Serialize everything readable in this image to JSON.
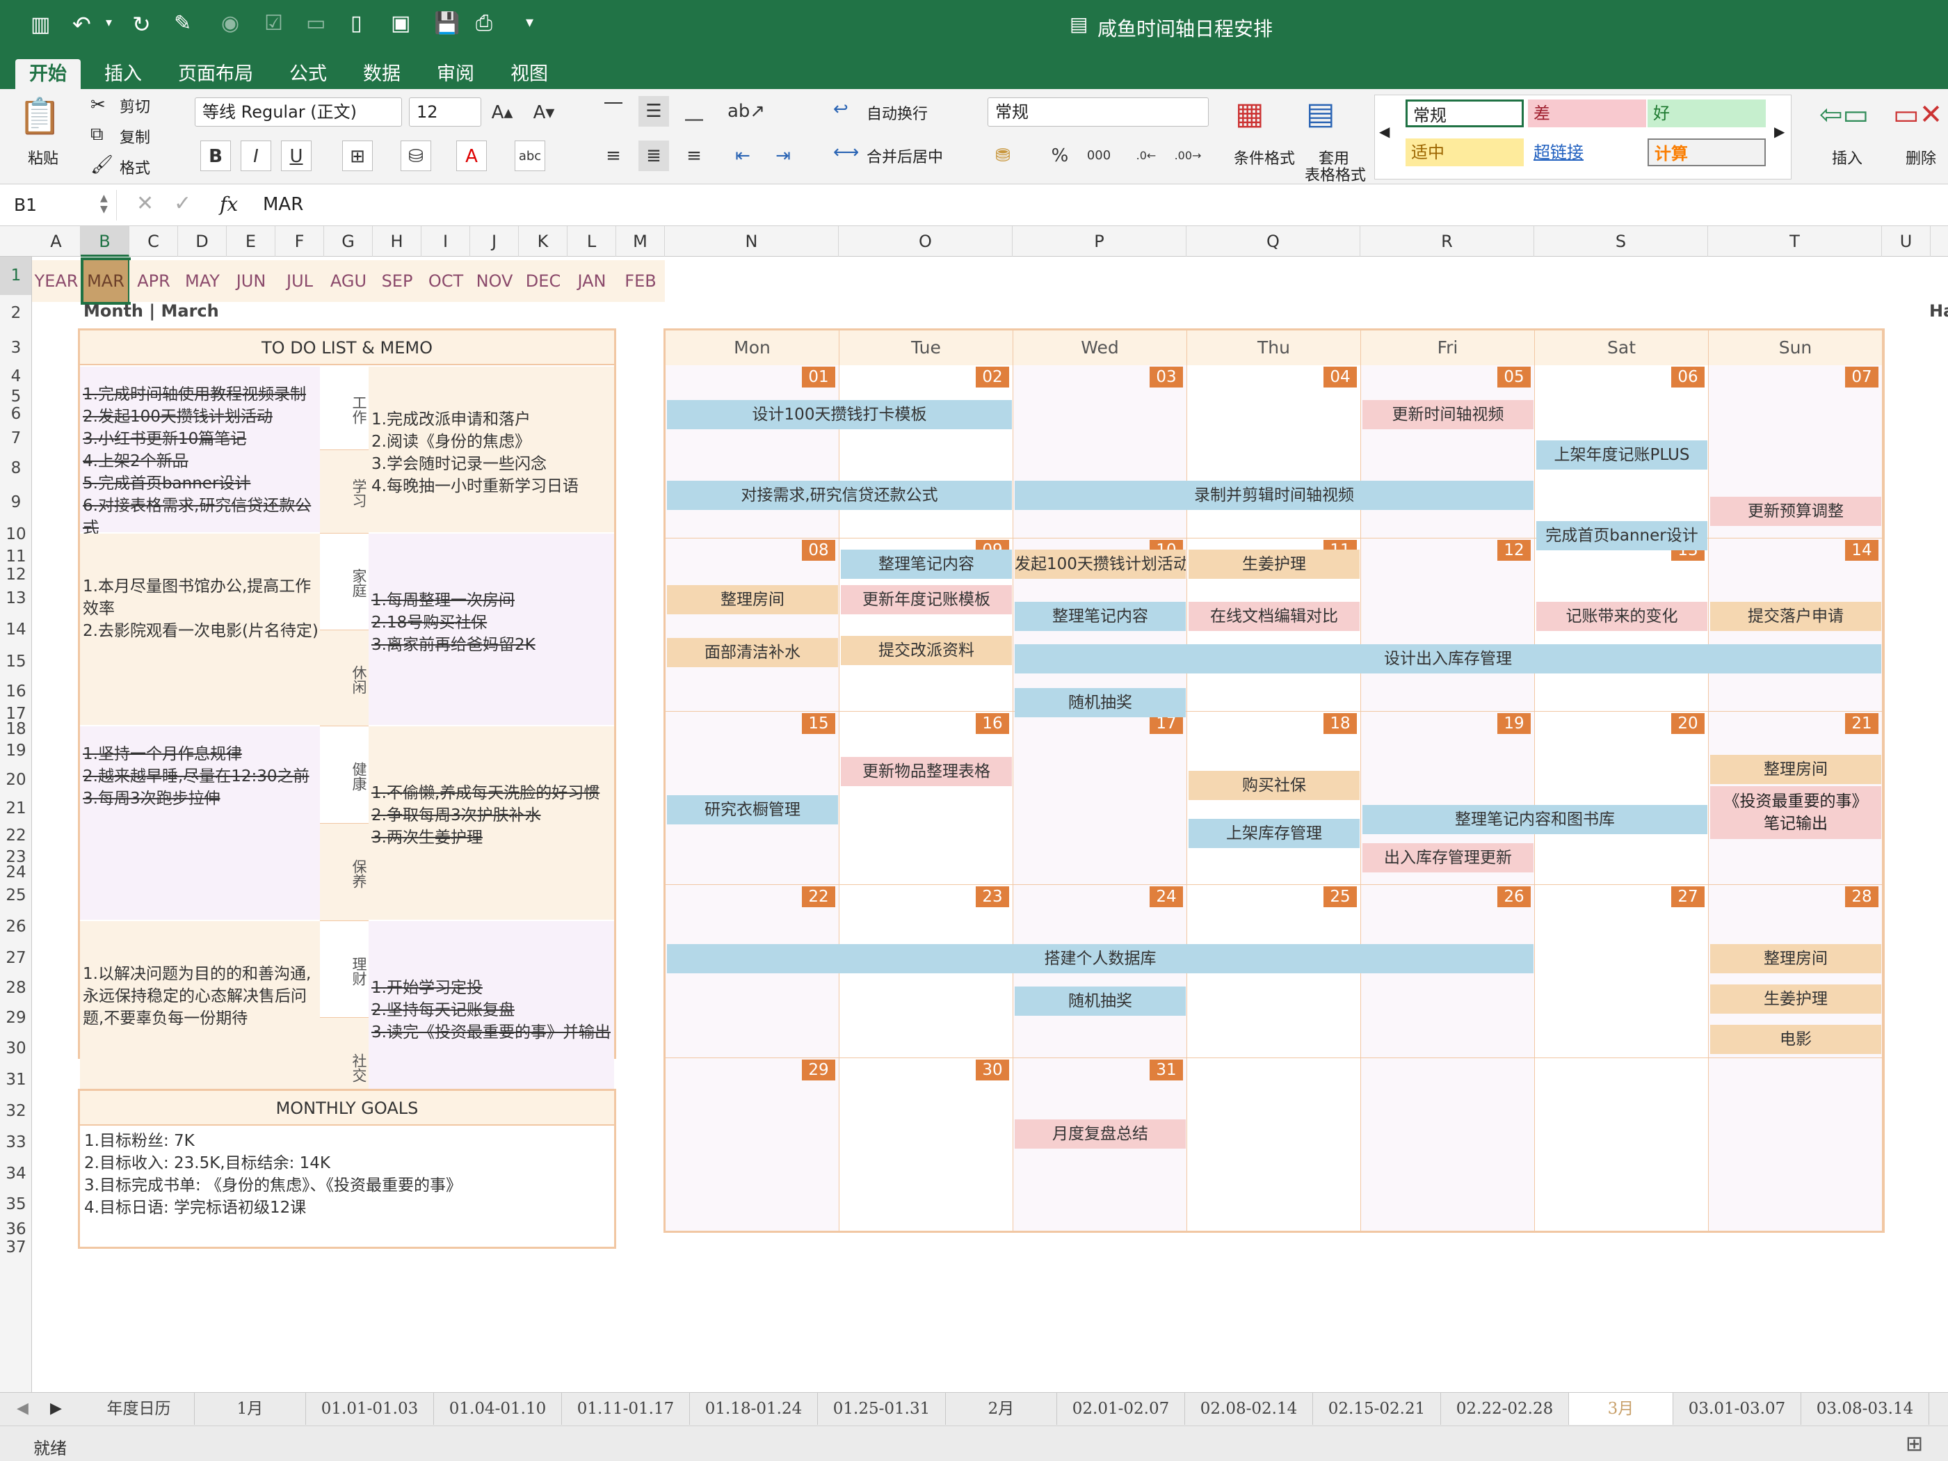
{
  "window": {
    "title": "咸鱼时间轴日程安排"
  },
  "ribbon_tabs": [
    "开始",
    "插入",
    "页面布局",
    "公式",
    "数据",
    "审阅",
    "视图"
  ],
  "ribbon": {
    "paste": "粘贴",
    "cut": "剪切",
    "copy": "复制",
    "format_painter": "格式",
    "font_name": "等线 Regular (正文)",
    "font_size": "12",
    "wrap_text": "自动换行",
    "merge_center": "合并后居中",
    "number_format": "常规",
    "conditional_format": "条件格式",
    "table_format_1": "套用",
    "table_format_2": "表格格式",
    "styles": {
      "normal": "常规",
      "bad": "差",
      "good": "好",
      "neutral": "适中",
      "hyperlink": "超链接",
      "calc": "计算"
    },
    "insert": "插入",
    "delete": "删除"
  },
  "formula_bar": {
    "cell_ref": "B1",
    "fx": "fx",
    "value": "MAR"
  },
  "columns": [
    "A",
    "B",
    "C",
    "D",
    "E",
    "F",
    "G",
    "H",
    "I",
    "J",
    "K",
    "L",
    "M",
    "N",
    "O",
    "P",
    "Q",
    "R",
    "S",
    "T",
    "U"
  ],
  "rows": [
    "1",
    "2",
    "3",
    "4",
    "5",
    "6",
    "7",
    "8",
    "9",
    "10",
    "11",
    "12",
    "13",
    "14",
    "15",
    "16",
    "17",
    "18",
    "19",
    "20",
    "21",
    "22",
    "23",
    "24",
    "25",
    "26",
    "27",
    "28",
    "29",
    "30",
    "31",
    "32",
    "33",
    "34",
    "35",
    "36",
    "37"
  ],
  "month_strip": [
    "YEAR",
    "MAR",
    "APR",
    "MAY",
    "JUN",
    "JUL",
    "AGU",
    "SEP",
    "OCT",
    "NOV",
    "DEC",
    "JAN",
    "FEB"
  ],
  "month_label": "Month | March",
  "right_edge_text": "Ha",
  "todo": {
    "title": "TO DO LIST & MEMO",
    "sections": [
      {
        "left": [
          "1.完成时间轴使用教程视频录制",
          "2.发起100天攒钱计划活动",
          "3.小红书更新10篇笔记",
          "4.上架2个新品",
          "5.完成首页banner设计",
          "6.对接表格需求,研究信贷还款公式"
        ],
        "cats": [
          "工作",
          "学习"
        ],
        "right": [
          "1.完成改派申请和落户",
          "2.阅读《身份的焦虑》",
          "3.学会随时记录一些闪念",
          "4.每晚抽一小时重新学习日语"
        ]
      },
      {
        "left": [
          "1.本月尽量图书馆办公,提高工作效率",
          "2.去影院观看一次电影(片名待定)"
        ],
        "cats": [
          "家庭",
          "休闲"
        ],
        "right": [
          "1.每周整理一次房间",
          "2.18号购买社保",
          "3.离家前再给爸妈留2K"
        ]
      },
      {
        "left": [
          "1.坚持一个月作息规律",
          "2.越来越早睡,尽量在12:30之前",
          "3.每周3次跑步拉伸"
        ],
        "cats": [
          "健康",
          "保养"
        ],
        "right": [
          "1.不偷懒,养成每天洗脸的好习惯",
          "2.争取每周3次护肤补水",
          "3.两次生姜护理"
        ]
      },
      {
        "left": [
          "1.以解决问题为目的的和善沟通,永远保持稳定的心态解决售后问题,不要辜负每一份期待"
        ],
        "cats": [
          "理财",
          "社交"
        ],
        "right": [
          "1.开始学习定投",
          "2.坚持每天记账复盘",
          "3.读完《投资最重要的事》并输出"
        ]
      }
    ]
  },
  "goals": {
    "title": "MONTHLY GOALS",
    "items": [
      "1.目标粉丝: 7K",
      "2.目标收入: 23.5K,目标结余: 14K",
      "3.目标完成书单: 《身份的焦虑》、《投资最重要的事》",
      "4.目标日语: 学完标语初级12课"
    ]
  },
  "calendar": {
    "weekdays": [
      "Mon",
      "Tue",
      "Wed",
      "Thu",
      "Fri",
      "Sat",
      "Sun"
    ],
    "weeks": [
      [
        "01",
        "02",
        "03",
        "04",
        "05",
        "06",
        "07"
      ],
      [
        "08",
        "09",
        "10",
        "11",
        "12",
        "13",
        "14"
      ],
      [
        "15",
        "16",
        "17",
        "18",
        "19",
        "20",
        "21"
      ],
      [
        "22",
        "23",
        "24",
        "25",
        "26",
        "27",
        "28"
      ],
      [
        "29",
        "30",
        "31",
        "",
        "",
        "",
        ""
      ]
    ],
    "events": [
      {
        "text": "设计100天攒钱打卡模板",
        "week": 0,
        "col": 0,
        "span": 2,
        "slot": 0,
        "color": "blue"
      },
      {
        "text": "更新时间轴视频",
        "week": 0,
        "col": 4,
        "span": 1,
        "slot": 0,
        "color": "pink"
      },
      {
        "text": "上架年度记账PLUS",
        "week": 0,
        "col": 5,
        "span": 1,
        "slot": 1,
        "color": "blue"
      },
      {
        "text": "对接需求,研究信贷还款公式",
        "week": 0,
        "col": 0,
        "span": 2,
        "slot": 2,
        "color": "blue"
      },
      {
        "text": "录制并剪辑时间轴视频",
        "week": 0,
        "col": 2,
        "span": 3,
        "slot": 2,
        "color": "blue"
      },
      {
        "text": "完成首页banner设计",
        "week": 0,
        "col": 5,
        "span": 1,
        "slot": 3,
        "color": "blue"
      },
      {
        "text": "更新预算调整",
        "week": 0,
        "col": 6,
        "span": 1,
        "slot": 2.4,
        "color": "pink"
      },
      {
        "text": "整理笔记内容",
        "week": 0,
        "col": 1,
        "span": 1,
        "slot": 3.7,
        "color": "blue"
      },
      {
        "text": "发起100天攒钱计划活动",
        "week": 0,
        "col": 2,
        "span": 1,
        "slot": 3.7,
        "color": "tan"
      },
      {
        "text": "生姜护理",
        "week": 0,
        "col": 3,
        "span": 1,
        "slot": 3.7,
        "color": "tan"
      },
      {
        "text": "整理房间",
        "week": 1,
        "col": 0,
        "span": 1,
        "slot": 0.3,
        "color": "tan"
      },
      {
        "text": "更新年度记账模板",
        "week": 1,
        "col": 1,
        "span": 1,
        "slot": 0.3,
        "color": "pink"
      },
      {
        "text": "整理笔记内容",
        "week": 1,
        "col": 2,
        "span": 1,
        "slot": 0.7,
        "color": "blue"
      },
      {
        "text": "在线文档编辑对比",
        "week": 1,
        "col": 3,
        "span": 1,
        "slot": 0.7,
        "color": "pink"
      },
      {
        "text": "记账带来的变化",
        "week": 1,
        "col": 5,
        "span": 1,
        "slot": 0.7,
        "color": "pink"
      },
      {
        "text": "提交落户申请",
        "week": 1,
        "col": 6,
        "span": 1,
        "slot": 0.7,
        "color": "tan"
      },
      {
        "text": "面部清洁补水",
        "week": 1,
        "col": 0,
        "span": 1,
        "slot": 1.6,
        "color": "tan"
      },
      {
        "text": "提交改派资料",
        "week": 1,
        "col": 1,
        "span": 1,
        "slot": 1.55,
        "color": "tan"
      },
      {
        "text": "设计出入库存管理",
        "week": 1,
        "col": 2,
        "span": 5,
        "slot": 1.75,
        "color": "blue"
      },
      {
        "text": "随机抽奖",
        "week": 1,
        "col": 2,
        "span": 1,
        "slot": 2.85,
        "color": "blue"
      },
      {
        "text": "更新物品整理表格",
        "week": 2,
        "col": 1,
        "span": 1,
        "slot": 0.25,
        "color": "pink"
      },
      {
        "text": "整理房间",
        "week": 2,
        "col": 6,
        "span": 1,
        "slot": 0.2,
        "color": "tan"
      },
      {
        "text": "购买社保",
        "week": 2,
        "col": 3,
        "span": 1,
        "slot": 0.6,
        "color": "tan"
      },
      {
        "text": "研究衣橱管理",
        "week": 2,
        "col": 0,
        "span": 1,
        "slot": 1.2,
        "color": "blue"
      },
      {
        "text": "整理笔记内容和图书库",
        "week": 2,
        "col": 4,
        "span": 2,
        "slot": 1.45,
        "color": "blue"
      },
      {
        "text": "上架库存管理",
        "week": 2,
        "col": 3,
        "span": 1,
        "slot": 1.8,
        "color": "blue"
      },
      {
        "text": "出入库存管理更新",
        "week": 2,
        "col": 4,
        "span": 1,
        "slot": 2.4,
        "color": "pink"
      },
      {
        "text": "搭建个人数据库",
        "week": 3,
        "col": 0,
        "span": 5,
        "slot": 0.6,
        "color": "blue"
      },
      {
        "text": "整理房间",
        "week": 3,
        "col": 6,
        "span": 1,
        "slot": 0.6,
        "color": "tan"
      },
      {
        "text": "随机抽奖",
        "week": 3,
        "col": 2,
        "span": 1,
        "slot": 1.65,
        "color": "blue"
      },
      {
        "text": "生姜护理",
        "week": 3,
        "col": 6,
        "span": 1,
        "slot": 1.6,
        "color": "tan"
      },
      {
        "text": "电影",
        "week": 3,
        "col": 6,
        "span": 1,
        "slot": 2.6,
        "color": "tan"
      },
      {
        "text": "月度复盘总结",
        "week": 4,
        "col": 2,
        "span": 1,
        "slot": 0.65,
        "color": "pink"
      }
    ],
    "tall_event": {
      "text_1": "《投资最重要的事》",
      "text_2": "笔记输出"
    }
  },
  "sheet_tabs": [
    "年度日历",
    "1月",
    "01.01-01.03",
    "01.04-01.10",
    "01.11-01.17",
    "01.18-01.24",
    "01.25-01.31",
    "2月",
    "02.01-02.07",
    "02.08-02.14",
    "02.15-02.21",
    "02.22-02.28",
    "3月",
    "03.01-03.07",
    "03.08-03.14"
  ],
  "active_sheet": "3月",
  "status": "就绪",
  "colors": {
    "excel_green": "#217346",
    "accent_orange": "#e07f3c",
    "event_blue": "#b4d8e8",
    "event_pink": "#f6cfcf",
    "event_tan": "#f5d7b1",
    "panel_border": "#f1c7a3"
  }
}
